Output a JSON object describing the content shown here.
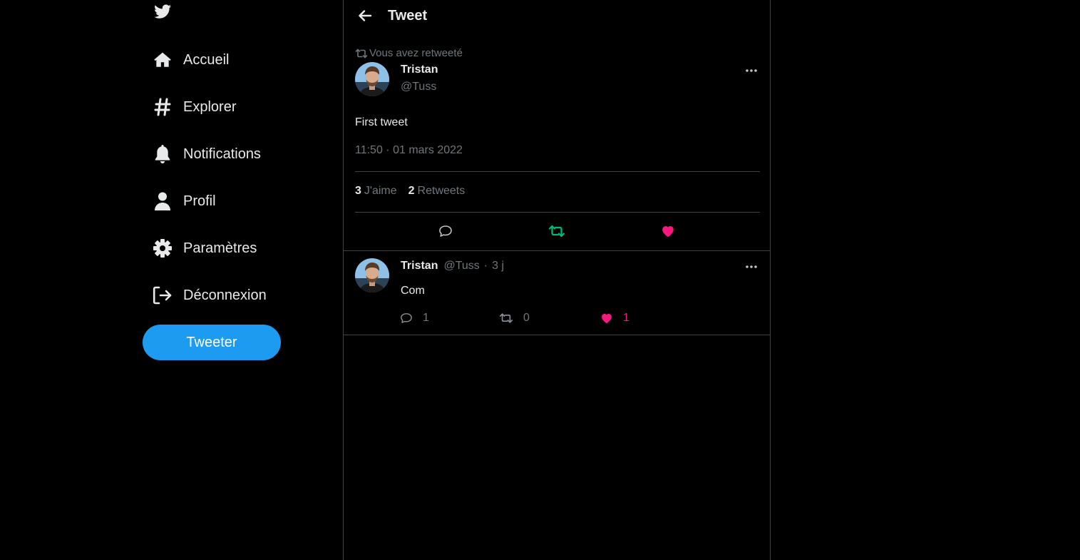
{
  "sidebar": {
    "logo_icon": "twitter-bird-icon",
    "items": [
      {
        "label": "Accueil",
        "icon": "home-icon"
      },
      {
        "label": "Explorer",
        "icon": "hashtag-icon"
      },
      {
        "label": "Notifications",
        "icon": "bell-icon"
      },
      {
        "label": "Profil",
        "icon": "user-icon"
      },
      {
        "label": "Paramètres",
        "icon": "gear-icon"
      },
      {
        "label": "Déconnexion",
        "icon": "logout-icon"
      }
    ],
    "tweet_button": "Tweeter"
  },
  "header": {
    "title": "Tweet",
    "back_icon": "back-arrow-icon"
  },
  "tweet": {
    "retweet_notice": "Vous avez retweeté",
    "author": {
      "name": "Tristan",
      "handle": "@Tuss"
    },
    "text": "First tweet",
    "timestamp": "11:50 · 01 mars 2022",
    "stats": {
      "likes_count": "3",
      "likes_label": "J'aime",
      "retweets_count": "2",
      "retweets_label": "Retweets"
    },
    "actions": {
      "retweeted": true,
      "liked": true
    }
  },
  "reply": {
    "author": {
      "name": "Tristan",
      "handle": "@Tuss"
    },
    "separator": "·",
    "age": "3 j",
    "text": "Com",
    "counts": {
      "comments": "1",
      "retweets": "0",
      "likes": "1"
    },
    "liked": true
  },
  "colors": {
    "background": "#000000",
    "accent_blue": "#1d9bf0",
    "retweet_green": "#00ba7c",
    "like_pink": "#f91880",
    "muted_text": "#71767b",
    "border": "#3f4246"
  }
}
